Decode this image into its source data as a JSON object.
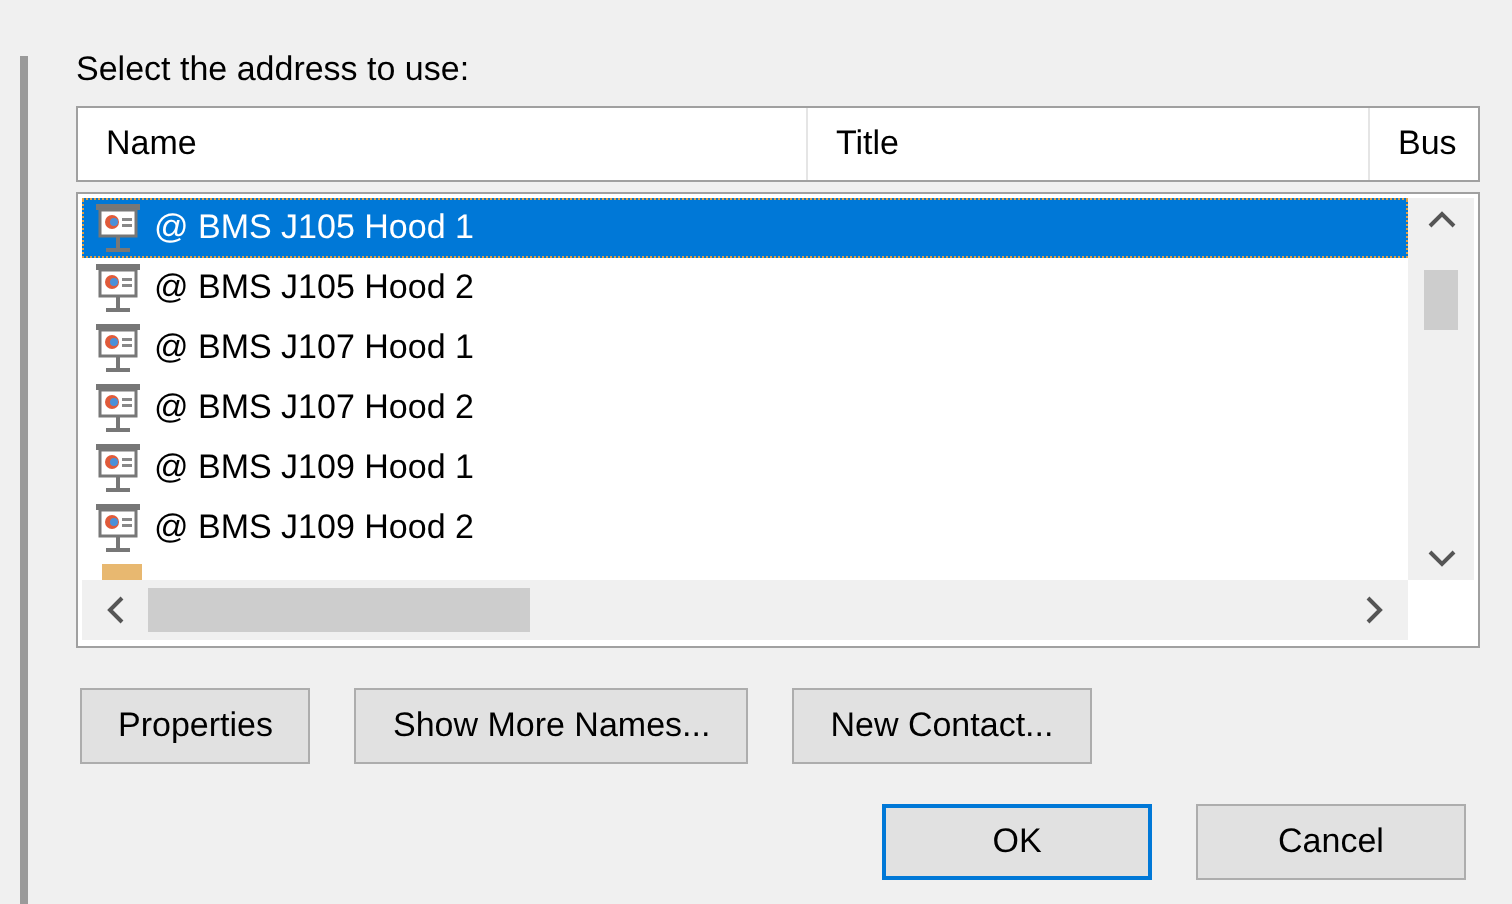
{
  "prompt": "Select the address to use:",
  "columns": [
    "Name",
    "Title",
    "Bus"
  ],
  "rows": [
    {
      "name": "@ BMS J105 Hood 1",
      "selected": true
    },
    {
      "name": "@ BMS J105 Hood 2",
      "selected": false
    },
    {
      "name": "@ BMS J107 Hood 1",
      "selected": false
    },
    {
      "name": "@ BMS J107 Hood 2",
      "selected": false
    },
    {
      "name": "@ BMS J109 Hood 1",
      "selected": false
    },
    {
      "name": "@ BMS J109 Hood 2",
      "selected": false
    }
  ],
  "buttons": [
    "Properties",
    "Show More Names...",
    "New Contact..."
  ],
  "dialog_buttons": [
    {
      "label": "OK",
      "default": true
    },
    {
      "label": "Cancel",
      "default": false
    }
  ]
}
